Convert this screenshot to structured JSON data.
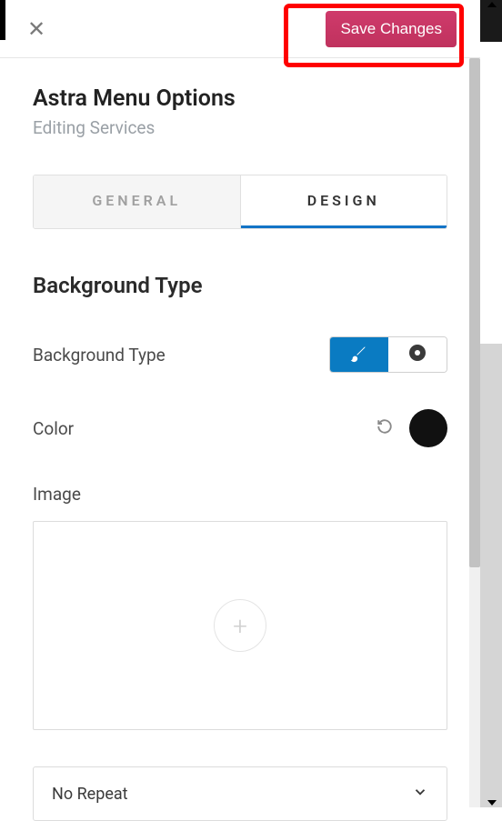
{
  "header": {
    "save_label": "Save Changes"
  },
  "title": "Astra Menu Options",
  "subtitle": "Editing Services",
  "tabs": {
    "general": "GENERAL",
    "design": "DESIGN"
  },
  "section": {
    "heading": "Background Type",
    "bg_type_label": "Background Type",
    "color_label": "Color",
    "image_label": "Image",
    "repeat_value": "No Repeat",
    "color_value": "#111111"
  }
}
